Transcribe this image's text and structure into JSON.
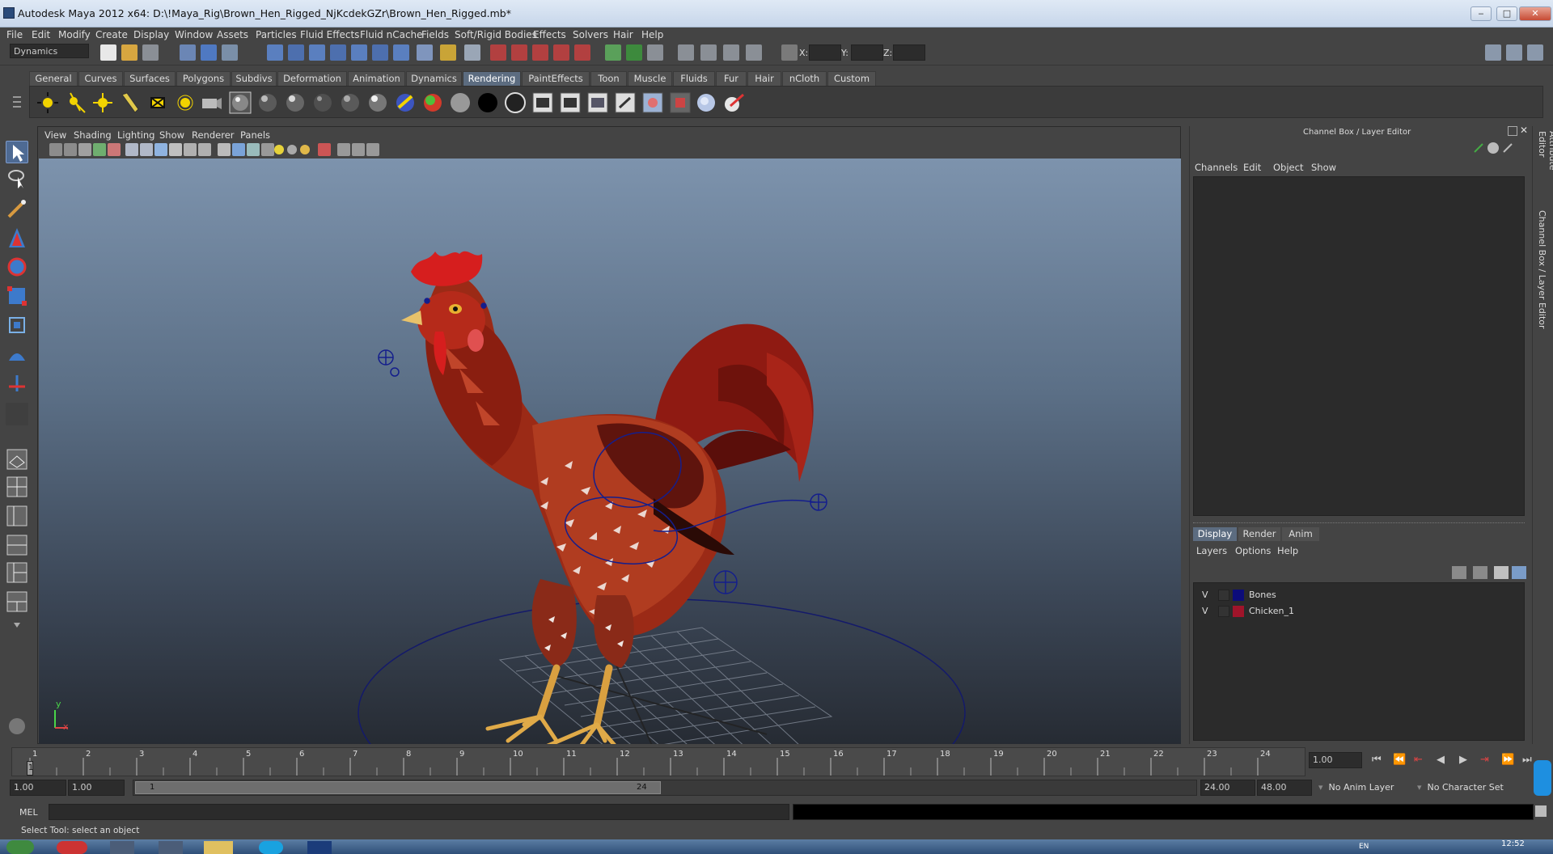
{
  "window": {
    "title": "Autodesk Maya 2012 x64: D:\\!Maya_Rig\\Brown_Hen_Rigged_NjKcdekGZr\\Brown_Hen_Rigged.mb*",
    "controls": [
      "‒",
      "□",
      "✕"
    ]
  },
  "menubar": {
    "items": [
      "File",
      "Edit",
      "Modify",
      "Create",
      "Display",
      "Window",
      "Assets",
      "Particles",
      "Fluid Effects",
      "Fluid nCache",
      "Fields",
      "Soft/Rigid Bodies",
      "Effects",
      "Solvers",
      "Hair",
      "Help"
    ]
  },
  "statusline": {
    "menuset": "Dynamics",
    "x_label": "X:",
    "y_label": "Y:",
    "z_label": "Z:"
  },
  "shelf": {
    "tabs": [
      "General",
      "Curves",
      "Surfaces",
      "Polygons",
      "Subdivs",
      "Deformation",
      "Animation",
      "Dynamics",
      "Rendering",
      "PaintEffects",
      "Toon",
      "Muscle",
      "Fluids",
      "Fur",
      "Hair",
      "nCloth",
      "Custom"
    ],
    "active_tab": "Rendering"
  },
  "viewport": {
    "menus": [
      "View",
      "Shading",
      "Lighting",
      "Show",
      "Renderer",
      "Panels"
    ],
    "axis": {
      "y": "y",
      "x": "x"
    }
  },
  "channel_box": {
    "header": "Channel Box / Layer Editor",
    "menus": [
      "Channels",
      "Edit",
      "Object",
      "Show"
    ]
  },
  "layer_editor": {
    "tabs": [
      "Display",
      "Render",
      "Anim"
    ],
    "active_tab": "Display",
    "menus": [
      "Layers",
      "Options",
      "Help"
    ],
    "layers": [
      {
        "visible": "V",
        "name": "Bones",
        "color": "#0c0c7a"
      },
      {
        "visible": "V",
        "name": "Chicken_1",
        "color": "#a0142a"
      }
    ]
  },
  "side_tabs": [
    "Attribute Editor",
    "Channel Box / Layer Editor"
  ],
  "timeline": {
    "ticks": [
      "1",
      "2",
      "3",
      "4",
      "5",
      "6",
      "7",
      "8",
      "9",
      "10",
      "11",
      "12",
      "13",
      "14",
      "15",
      "16",
      "17",
      "18",
      "19",
      "20",
      "21",
      "22",
      "23",
      "24"
    ],
    "current_frame_marker": "1",
    "current_time": "1.00"
  },
  "range": {
    "start_time": "1.00",
    "start_playback": "1.00",
    "slider_start": "1",
    "slider_end": "24",
    "end_playback": "24.00",
    "end_time": "48.00",
    "anim_layer": "No Anim Layer",
    "character_set": "No Character Set"
  },
  "command_line": {
    "label": "MEL"
  },
  "help_line": {
    "text": "Select Tool: select an object"
  },
  "taskbar": {
    "clock": "12:52",
    "lang": "EN"
  }
}
